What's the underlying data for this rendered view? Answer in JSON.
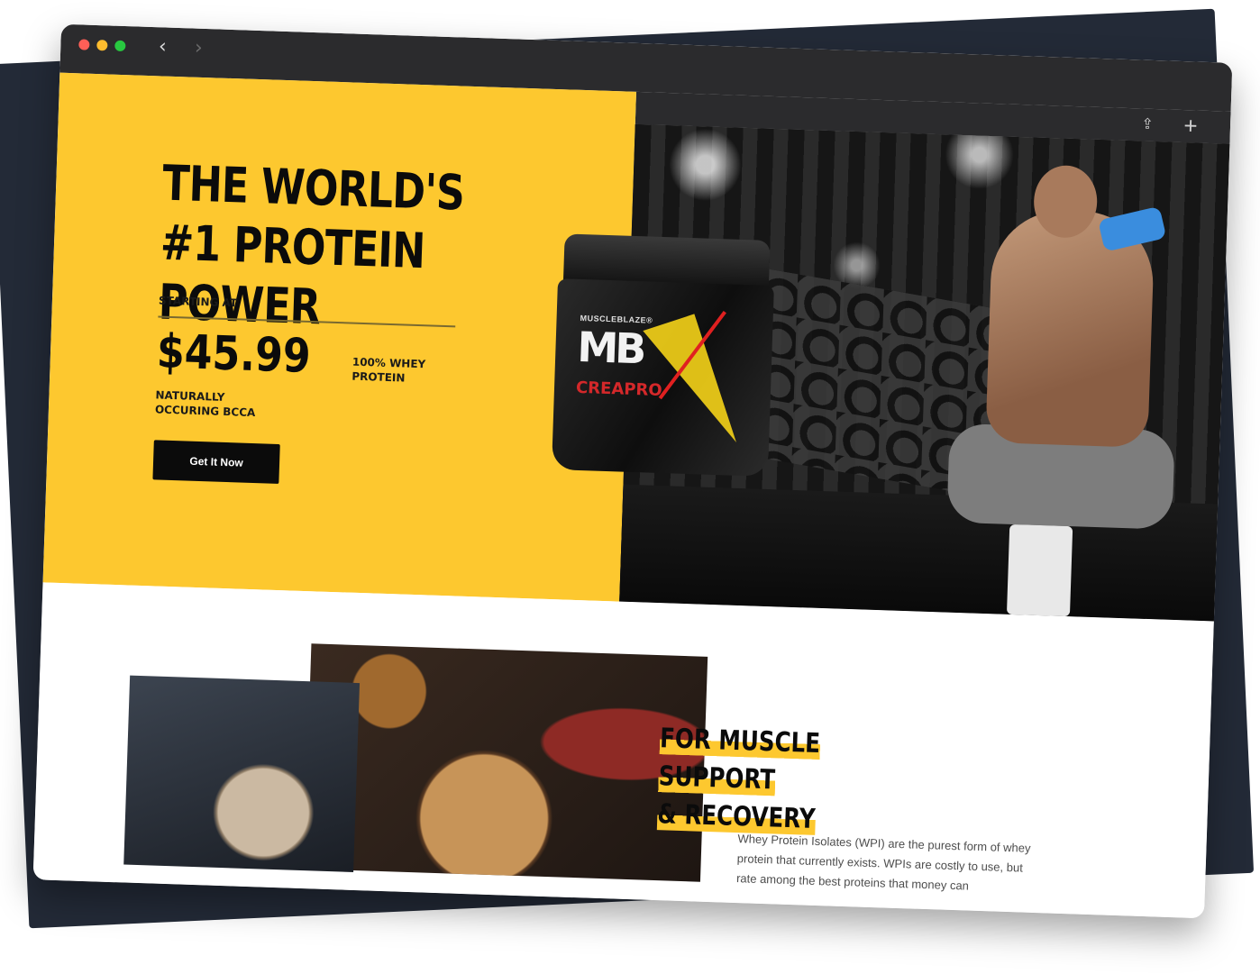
{
  "browser": {
    "back_icon": "chevron-left-icon",
    "forward_icon": "chevron-right-icon",
    "share_icon": "share-icon",
    "new_tab_icon": "plus-icon"
  },
  "hero": {
    "headline": "THE WORLD'S #1 PROTEIN POWER",
    "starting_label": "STARTING AT",
    "price": "$45.99",
    "whey_note": "100% WHEY PROTEIN",
    "bcaa_note": "NATURALLY OCCURING BCCA",
    "cta_label": "Get It Now"
  },
  "product": {
    "brand": "MUSCLEBLAZE®",
    "logo": "MB",
    "name": "CREAPRO"
  },
  "section2": {
    "title_line1": "FOR MUSCLE SUPPORT",
    "title_line2": "& RECOVERY",
    "body": "Whey Protein Isolates (WPI) are the purest form of whey protein that currently exists. WPIs are costly to use, but rate among the best proteins that money can"
  },
  "colors": {
    "accent_yellow": "#fdc82f",
    "dark": "#0b0b0b",
    "backdrop": "#232a37"
  }
}
